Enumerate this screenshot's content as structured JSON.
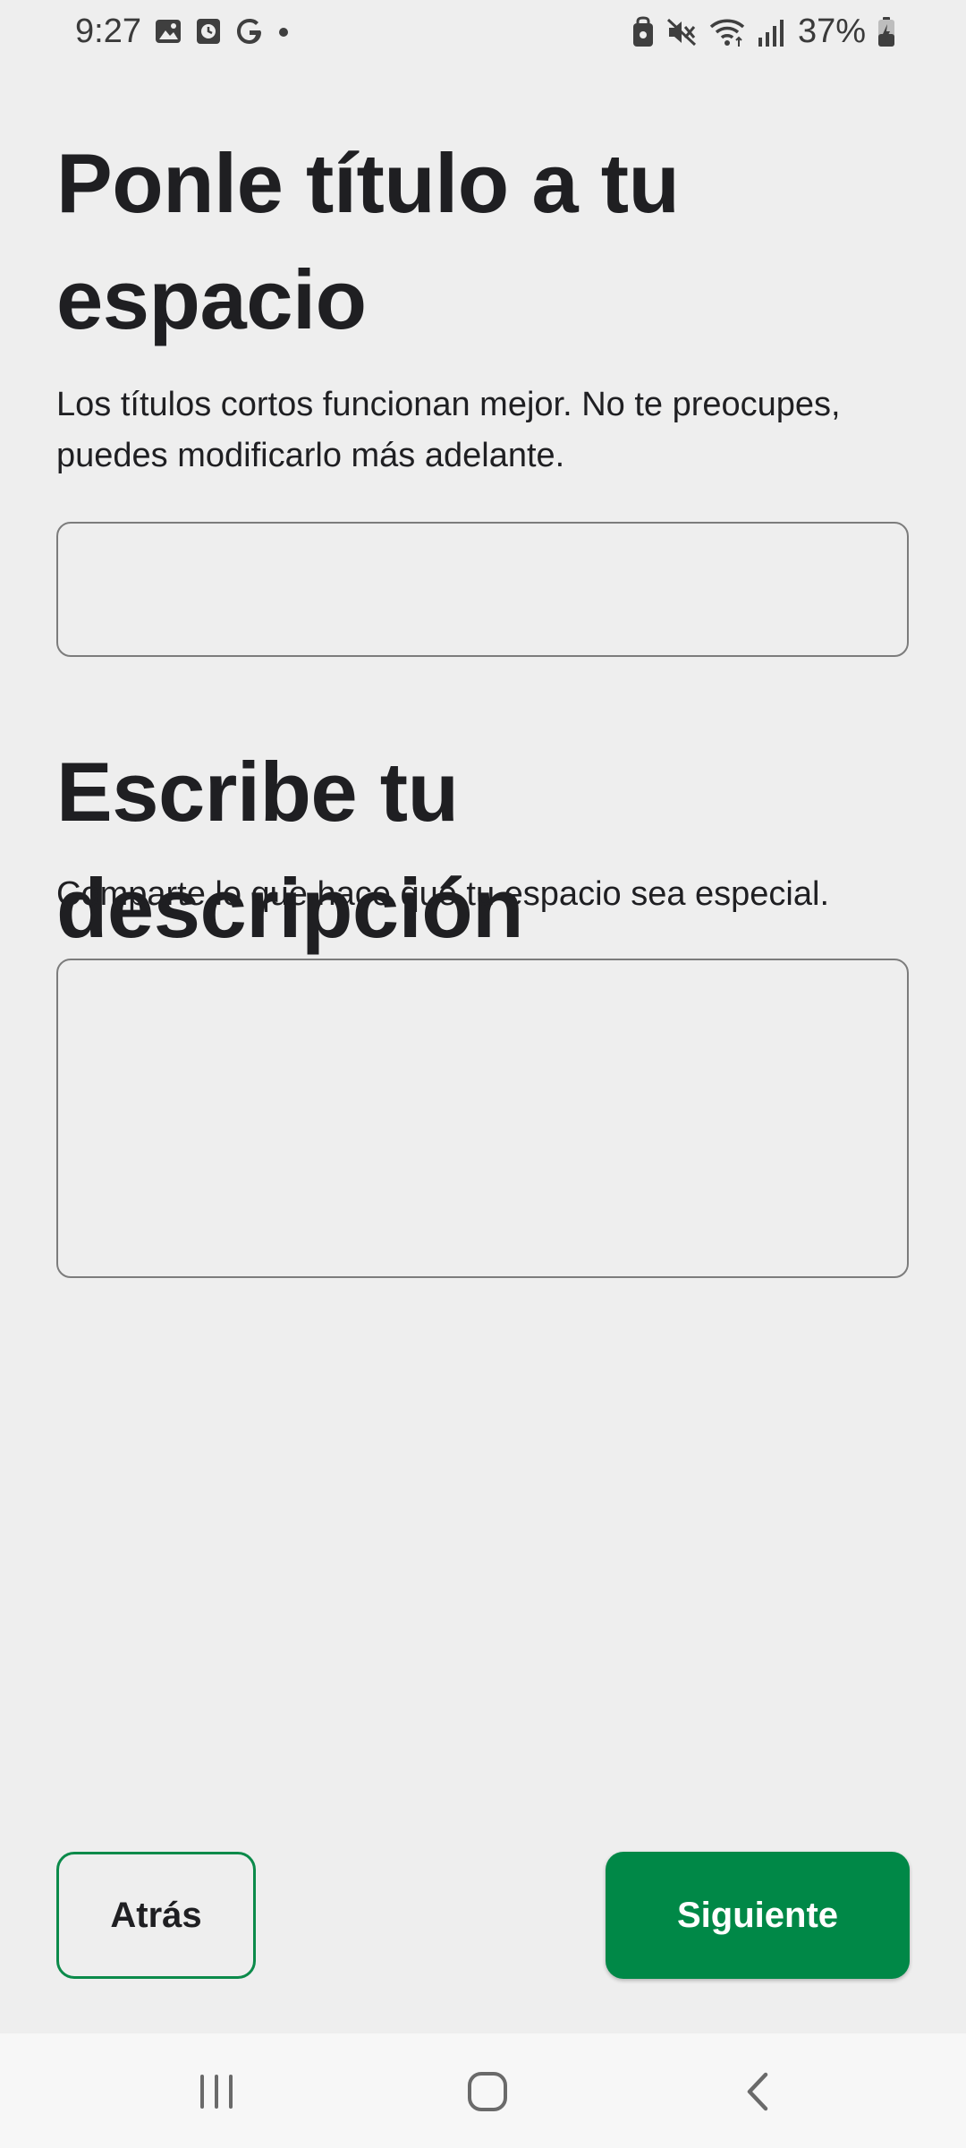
{
  "status_bar": {
    "time": "9:27",
    "battery": "37%",
    "left_icons": [
      "gallery-icon",
      "clock-notification-icon",
      "google-icon",
      "dot-icon"
    ],
    "right_icons": [
      "lock-icon",
      "mute-icon",
      "wifi-icon",
      "signal-icon",
      "battery-icon"
    ]
  },
  "title_section": {
    "heading": "Ponle título a tu espacio",
    "helper": "Los títulos cortos funcionan mejor. No te preocupes, puedes modificarlo más adelante.",
    "input_value": "",
    "input_placeholder": ""
  },
  "description_section": {
    "heading": "Escribe tu descripción",
    "helper": "Comparte lo que hace que tu espacio sea especial.",
    "input_value": "",
    "input_placeholder": ""
  },
  "footer": {
    "back_label": "Atrás",
    "next_label": "Siguiente"
  },
  "nav": {
    "icons": [
      "recents-icon",
      "home-icon",
      "back-icon"
    ]
  },
  "colors": {
    "accent": "#008847",
    "background": "#eeeeee",
    "text": "#1f1f22"
  }
}
